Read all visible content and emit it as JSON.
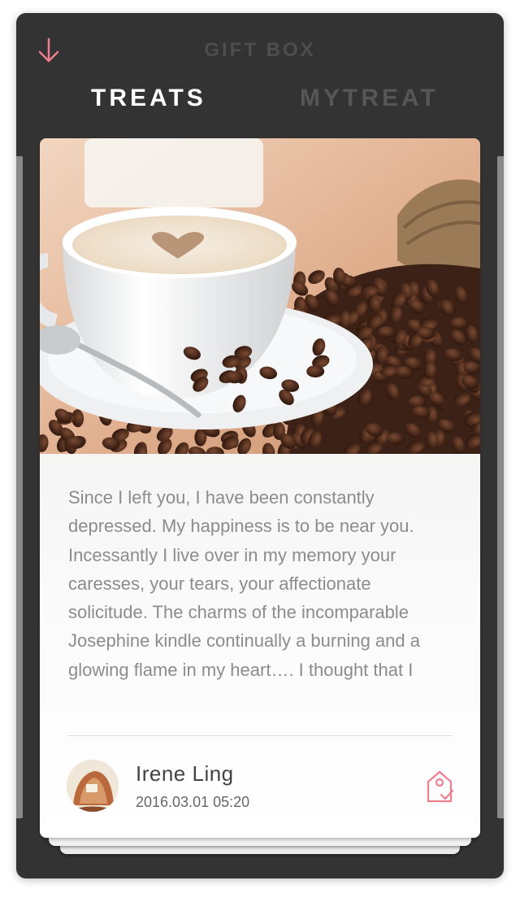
{
  "colors": {
    "accent": "#ef7e8e",
    "frame": "#333333",
    "tab_active": "#ffffff",
    "tab_inactive": "#565656",
    "body_text": "#8c8c8c"
  },
  "header": {
    "back_icon": "arrow-down-icon",
    "title": "GIFT BOX"
  },
  "tabs": [
    {
      "label": "TREATS",
      "active": true
    },
    {
      "label": "MYTREAT",
      "active": false
    }
  ],
  "card": {
    "image": "coffee-cup-with-heart-latte-art-and-coffee-beans",
    "body": "Since I left you, I have been constantly depressed. My happiness is to be near you. Incessantly I live over in my memory your caresses, your tears, your affectionate solicitude. The charms of the incomparable Josephine kindle continually a burning and a glowing flame in my heart…. I thought that I",
    "author": {
      "name": "Irene Ling",
      "time": "2016.03.01 05:20",
      "avatar": "avatar-photo"
    },
    "tag_icon": "tag-check-icon"
  }
}
